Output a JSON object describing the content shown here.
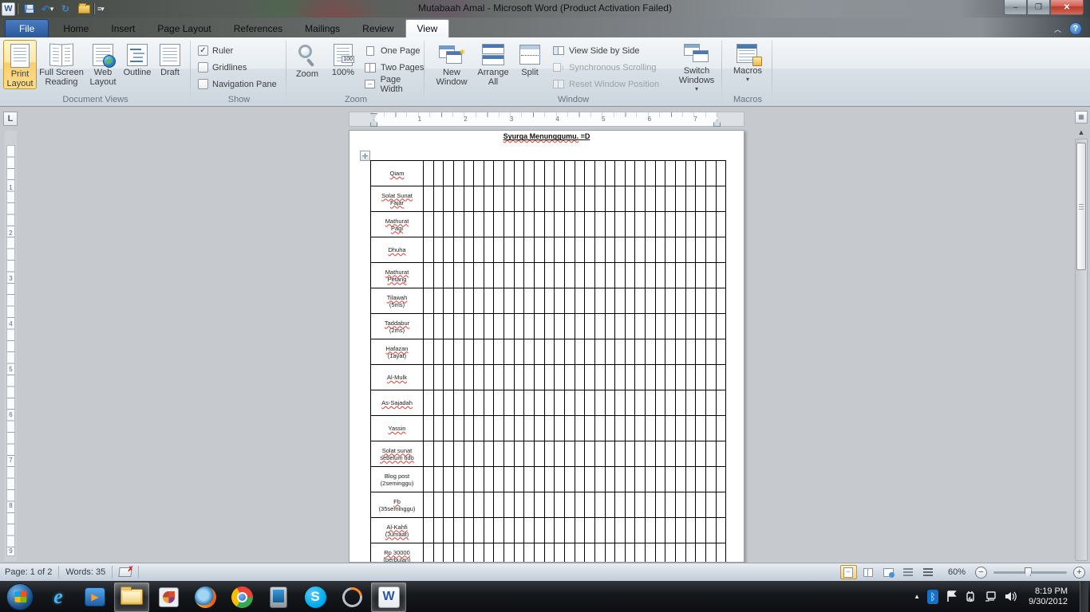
{
  "colors": {
    "accent_blue": "#2b579a",
    "selected_orange": "#fbce6f",
    "spell_red": "#e03c31",
    "close_red": "#bc3a2a"
  },
  "titlebar": {
    "title": "Mutabaah Amal  -  Microsoft Word (Product Activation Failed)",
    "minimize": "–",
    "restore": "❐",
    "close": "✕",
    "undo_glyph": "↶",
    "redo_glyph": "↻",
    "qat_drop_glyph": "▾"
  },
  "tabs": {
    "file": "File",
    "items": [
      "Home",
      "Insert",
      "Page Layout",
      "References",
      "Mailings",
      "Review",
      "View"
    ],
    "active": "View",
    "min_chevron": "︿",
    "help_glyph": "?"
  },
  "ribbon": {
    "document_views": {
      "label": "Document Views",
      "print_layout": "Print\nLayout",
      "full_screen": "Full Screen\nReading",
      "web_layout": "Web\nLayout",
      "outline": "Outline",
      "draft": "Draft"
    },
    "show": {
      "label": "Show",
      "items": [
        {
          "label": "Ruler",
          "checked": true
        },
        {
          "label": "Gridlines",
          "checked": false
        },
        {
          "label": "Navigation Pane",
          "checked": false
        }
      ],
      "check_glyph": "✓"
    },
    "zoom": {
      "label": "Zoom",
      "zoom": "Zoom",
      "pct": "100%",
      "one_page": "One Page",
      "two_pages": "Two Pages",
      "page_width": "Page Width"
    },
    "window": {
      "label": "Window",
      "new_window": "New\nWindow",
      "arrange_all": "Arrange\nAll",
      "split": "Split",
      "side_by_side": "View Side by Side",
      "sync_scroll": "Synchronous Scrolling",
      "reset_pos": "Reset Window Position",
      "switch_windows": "Switch\nWindows",
      "drop_glyph": "▾"
    },
    "macros": {
      "label": "Macros",
      "macros": "Macros",
      "drop_glyph": "▾"
    }
  },
  "document": {
    "tab_selector": "L",
    "title_part1": "Syurga Menunggumu.",
    "title_part2": " =D",
    "move_handle_glyph": "✛",
    "hruler_numbers": [
      1,
      2,
      3,
      4,
      5,
      6,
      7
    ],
    "vruler_numbers": [
      1,
      2,
      3,
      4,
      5,
      6,
      7,
      8,
      9
    ],
    "table": {
      "day_columns": 30,
      "rows": [
        {
          "lines": [
            {
              "t": "Qiam",
              "w": true
            }
          ]
        },
        {
          "lines": [
            {
              "t": "Solat Sunat",
              "w": true
            },
            {
              "t": "Fajar",
              "w": true
            }
          ]
        },
        {
          "lines": [
            {
              "t": "Mathurat",
              "w": true
            },
            {
              "t": "Pagi",
              "w": true
            }
          ]
        },
        {
          "lines": [
            {
              "t": "Dhuha",
              "w": true
            }
          ]
        },
        {
          "lines": [
            {
              "t": "Mathurat",
              "w": true
            },
            {
              "t": "Petang",
              "w": true
            }
          ]
        },
        {
          "lines": [
            {
              "t": "Tilawah",
              "w": true
            },
            {
              "t": "(5ms)",
              "w": false
            }
          ]
        },
        {
          "lines": [
            {
              "t": "Taddabur",
              "w": true
            },
            {
              "t": "(2ms)",
              "w": false
            }
          ]
        },
        {
          "lines": [
            {
              "t": "Hafazan",
              "w": true
            },
            {
              "t": "(1ayat)",
              "w": false
            }
          ]
        },
        {
          "lines": [
            {
              "t": "Al-Mulk",
              "w": true
            }
          ]
        },
        {
          "lines": [
            {
              "t": "As-Sajadah",
              "w": true
            }
          ]
        },
        {
          "lines": [
            {
              "t": "Yassin",
              "w": true
            }
          ]
        },
        {
          "lines": [
            {
              "t": "Solat sunat",
              "w": true
            },
            {
              "t": "sebelum tido",
              "w": true
            }
          ]
        },
        {
          "lines": [
            {
              "t": "Blog post",
              "w": false
            },
            {
              "t": "(2seminggu)",
              "w": false
            }
          ]
        },
        {
          "lines": [
            {
              "t": "Fb",
              "w": true
            },
            {
              "t": "(35seminggu)",
              "w": false
            }
          ]
        },
        {
          "lines": [
            {
              "t": "Al-Kahfi",
              "w": true
            },
            {
              "t": "(Jumaat)",
              "w": true
            }
          ]
        },
        {
          "lines": [
            {
              "t": "Rp 30000",
              "w": true
            },
            {
              "t": "(perbulan)",
              "w": true
            }
          ]
        }
      ]
    },
    "scroll_up_glyph": "▲"
  },
  "statusbar": {
    "page": "Page: 1 of 2",
    "words": "Words: 35",
    "zoom_level": "60%",
    "minus_glyph": "−",
    "plus_glyph": "+"
  },
  "taskbar": {
    "icons": [
      {
        "name": "start-button",
        "active": false
      },
      {
        "name": "internet-explorer",
        "active": false
      },
      {
        "name": "media-player",
        "active": false
      },
      {
        "name": "windows-explorer",
        "active": true
      },
      {
        "name": "photo-viewer",
        "active": false
      },
      {
        "name": "firefox",
        "active": false
      },
      {
        "name": "chrome",
        "active": false
      },
      {
        "name": "device-manager",
        "active": false
      },
      {
        "name": "skype",
        "active": false
      },
      {
        "name": "sync-app",
        "active": false
      },
      {
        "name": "word",
        "active": true
      }
    ],
    "tray": {
      "hidden_glyph": "▲",
      "time": "8:19 PM",
      "date": "9/30/2012"
    }
  }
}
